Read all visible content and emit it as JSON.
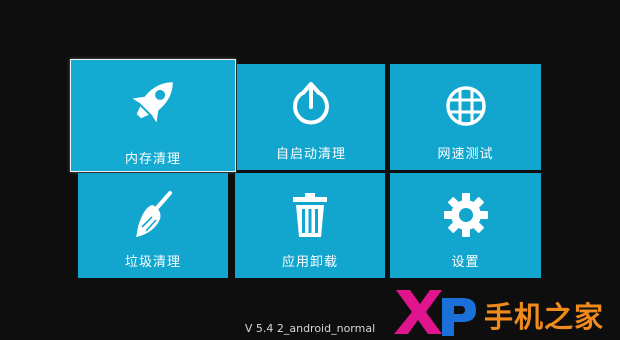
{
  "tiles": [
    {
      "label": "内存清理",
      "icon": "rocket-icon",
      "focused": true
    },
    {
      "label": "自启动清理",
      "icon": "power-icon",
      "focused": false
    },
    {
      "label": "网速测试",
      "icon": "globe-grid-icon",
      "focused": false
    },
    {
      "label": "垃圾清理",
      "icon": "broom-icon",
      "focused": false
    },
    {
      "label": "应用卸载",
      "icon": "trash-icon",
      "focused": false
    },
    {
      "label": "设置",
      "icon": "gear-icon",
      "focused": false
    }
  ],
  "version": "V 5.4 2_android_normal",
  "watermark": {
    "logo": "Xp",
    "text": "手机之家"
  },
  "colors": {
    "tile": "#12a6cf",
    "background": "#0e0e0e",
    "watermark_orange": "#f08a1c",
    "watermark_magenta": "#e0148c",
    "watermark_blue": "#1a6fd8"
  }
}
